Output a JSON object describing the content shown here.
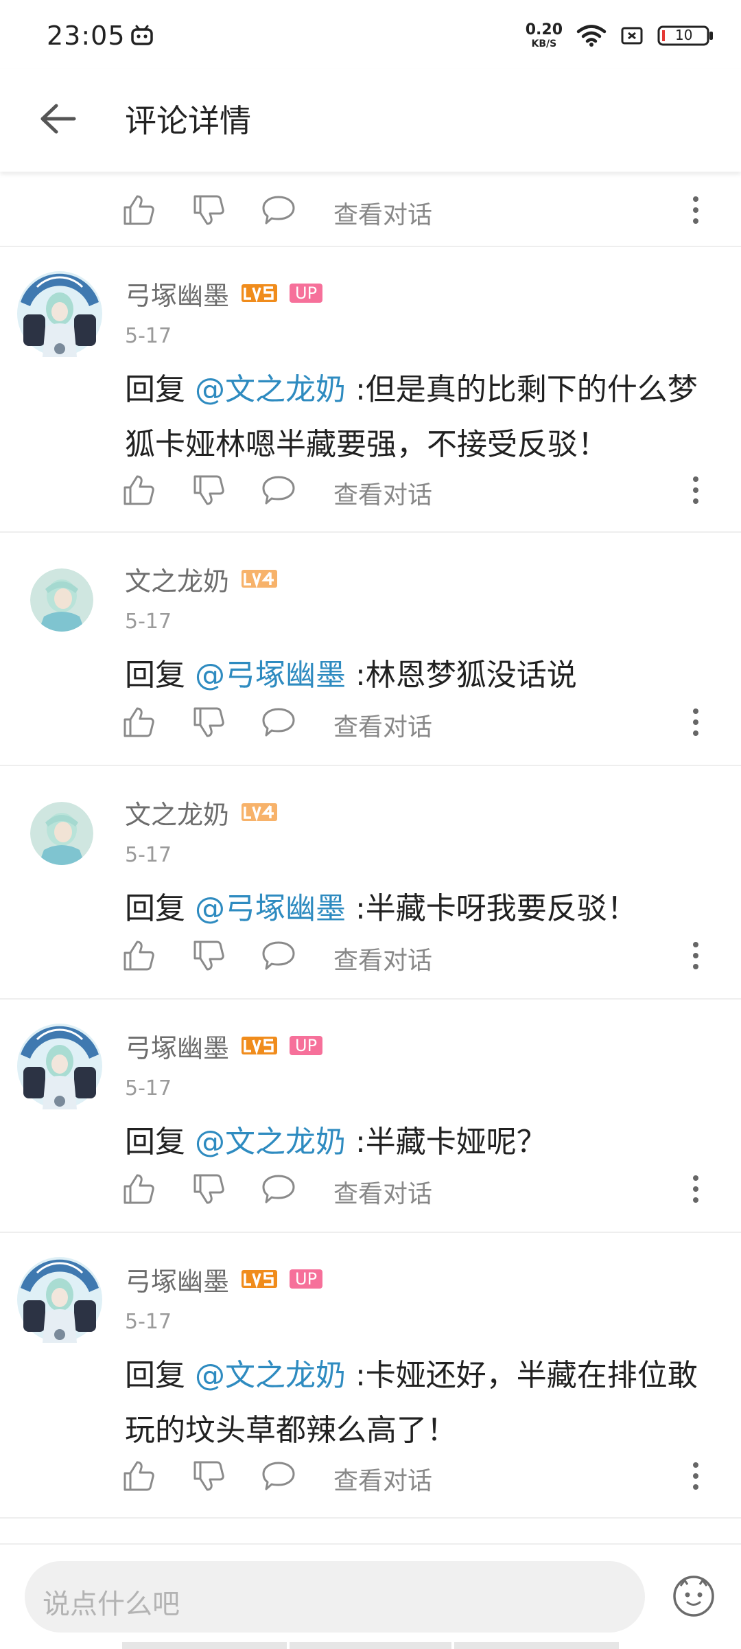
{
  "status": {
    "time": "23:05",
    "net_speed_value": "0.20",
    "net_speed_unit": "KB/S",
    "battery": "10"
  },
  "appbar": {
    "title": "评论详情"
  },
  "actions": {
    "view_dialog_label": "查看对话"
  },
  "reply_prefix": "回复 ",
  "comments": [
    {
      "user": "弓塚幽墨",
      "level": "LV5",
      "up_badge": "UP",
      "date": "5-17",
      "mention": "@文之龙奶",
      "text": " :但是真的比剩下的什么梦狐卡娅林嗯半藏要强，不接受反驳！"
    },
    {
      "user": "文之龙奶",
      "level": "LV4",
      "date": "5-17",
      "mention": "@弓塚幽墨",
      "text": " :林恩梦狐没话说"
    },
    {
      "user": "文之龙奶",
      "level": "LV4",
      "date": "5-17",
      "mention": "@弓塚幽墨",
      "text": " :半藏卡呀我要反驳！"
    },
    {
      "user": "弓塚幽墨",
      "level": "LV5",
      "up_badge": "UP",
      "date": "5-17",
      "mention": "@文之龙奶",
      "text": " :半藏卡娅呢？"
    },
    {
      "user": "弓塚幽墨",
      "level": "LV5",
      "up_badge": "UP",
      "date": "5-17",
      "mention": "@文之龙奶",
      "text": " :卡娅还好，半藏在排位敢玩的坟头草都辣么高了！"
    }
  ],
  "input": {
    "placeholder": "说点什么吧"
  },
  "colors": {
    "mention": "#2e8bc0",
    "lv5": "#f08c1c",
    "lv4": "#f7b26a",
    "up": "#f6709a"
  },
  "icons": [
    "back-arrow-icon",
    "thumb-up-icon",
    "thumb-down-icon",
    "comment-bubble-icon",
    "more-vertical-icon",
    "emoji-icon",
    "wifi-icon",
    "battery-icon",
    "bilibili-tv-icon"
  ]
}
